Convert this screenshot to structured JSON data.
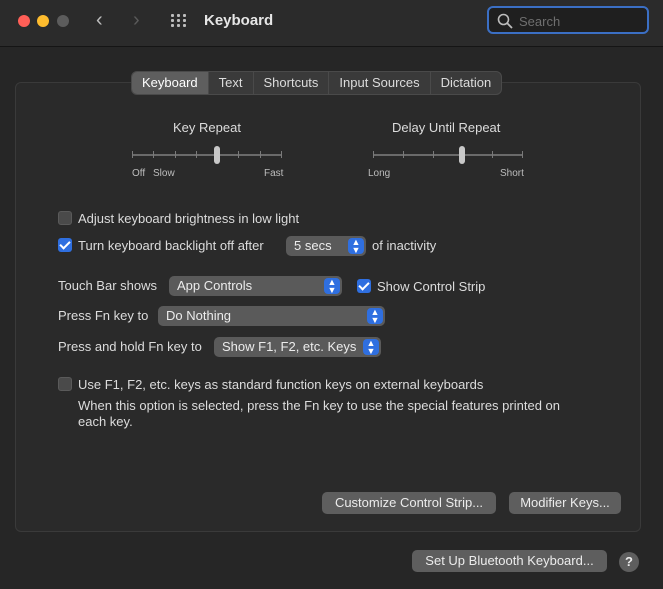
{
  "window": {
    "title": "Keyboard"
  },
  "search": {
    "placeholder": "Search",
    "value": ""
  },
  "tabs": [
    {
      "label": "Keyboard",
      "active": true
    },
    {
      "label": "Text",
      "active": false
    },
    {
      "label": "Shortcuts",
      "active": false
    },
    {
      "label": "Input Sources",
      "active": false
    },
    {
      "label": "Dictation",
      "active": false
    }
  ],
  "key_repeat": {
    "label": "Key Repeat",
    "min_label_1": "Off",
    "min_label_2": "Slow",
    "max_label": "Fast",
    "steps": 8,
    "level": 4
  },
  "delay_until_repeat": {
    "label": "Delay Until Repeat",
    "min_label": "Long",
    "max_label": "Short",
    "steps": 6,
    "level": 3
  },
  "options": {
    "brightness_label": "Adjust keyboard brightness in low light",
    "brightness_checked": false,
    "backlight_label": "Turn keyboard backlight off after",
    "backlight_checked": true,
    "backlight_value": "5 secs",
    "backlight_suffix": "of inactivity"
  },
  "touch_bar": {
    "label": "Touch Bar shows",
    "value": "App Controls",
    "control_strip_label": "Show Control Strip",
    "control_strip_checked": true
  },
  "fn_key": {
    "label": "Press Fn key to",
    "value": "Do Nothing"
  },
  "fn_hold": {
    "label": "Press and hold Fn key to",
    "value": "Show F1, F2, etc. Keys"
  },
  "function_keys": {
    "label": "Use F1, F2, etc. keys as standard function keys on external keyboards",
    "checked": false,
    "help_line1": "When this option is selected, press the Fn key to use the special features printed on",
    "help_line2": "each key."
  },
  "buttons": {
    "customize": "Customize Control Strip...",
    "modifier": "Modifier Keys...",
    "bluetooth": "Set Up Bluetooth Keyboard...",
    "help": "?"
  }
}
